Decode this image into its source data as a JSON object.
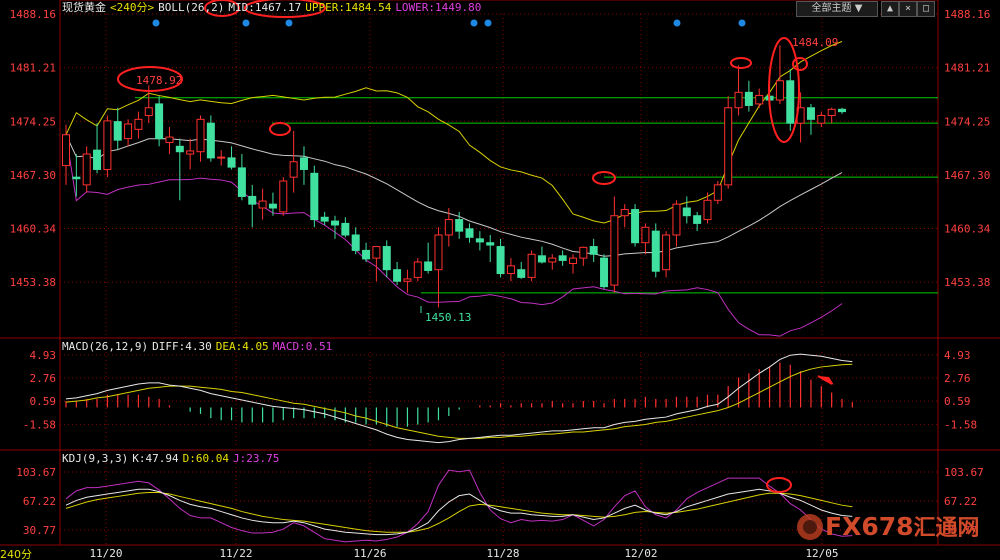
{
  "header": {
    "instrument": "现货黄金",
    "period": "<240分>",
    "boll_label": "BOLL(26,2)",
    "mid": "MID:1467.17",
    "upper": "UPPER:1484.54",
    "lower": "LOWER:1449.80",
    "theme_button": "全部主题",
    "theme_arrow": "▼"
  },
  "toolbar": {
    "up": "▲",
    "close": "×",
    "max": "□"
  },
  "macd_header": {
    "label": "MACD(26,12,9)",
    "diff": "DIFF:4.30",
    "dea": "DEA:4.05",
    "macd": "MACD:0.51"
  },
  "kdj_header": {
    "label": "KDJ(9,3,3)",
    "k": "K:47.94",
    "d": "D:60.04",
    "j": "J:23.75"
  },
  "period_button": "240分",
  "watermark": {
    "text": "FX678",
    "suffix": "汇通网"
  },
  "colors": {
    "up": "#ff3030",
    "down": "#40e0a0",
    "boll_mid": "#c8c8c8",
    "boll_upper": "#d8d000",
    "boll_lower": "#c030c0",
    "hline": "#00cc00",
    "grid": "#8b0000",
    "dea": "#d8d000",
    "diff": "#e8e8e8",
    "k": "#e8e8e8",
    "d": "#d8d000",
    "j": "#c030c0"
  },
  "chart_data": [
    {
      "type": "candlestick",
      "title": "现货黄金 240分",
      "y_ticks": [
        "1488.16",
        "1481.21",
        "1474.25",
        "1467.30",
        "1460.34",
        "1453.38"
      ],
      "ylim": [
        1446.4,
        1488.16
      ],
      "x_labels": [
        "11/20",
        "11/22",
        "11/26",
        "11/28",
        "12/02",
        "12/05"
      ],
      "candles": [
        [
          1468.5,
          1473.8,
          1466.0,
          1472.5
        ],
        [
          1467.0,
          1470.0,
          1464.5,
          1466.8
        ],
        [
          1466.0,
          1471.0,
          1465.0,
          1470.0
        ],
        [
          1470.5,
          1474.0,
          1467.5,
          1468.0
        ],
        [
          1468.0,
          1475.0,
          1467.0,
          1474.3
        ],
        [
          1474.2,
          1476.0,
          1470.5,
          1471.8
        ],
        [
          1472.0,
          1474.5,
          1471.0,
          1473.9
        ],
        [
          1473.2,
          1475.5,
          1472.0,
          1474.5
        ],
        [
          1475.0,
          1478.9,
          1474.0,
          1476.0
        ],
        [
          1476.5,
          1477.5,
          1471.0,
          1472.0
        ],
        [
          1471.5,
          1473.5,
          1470.0,
          1472.2
        ],
        [
          1471.0,
          1472.0,
          1464.0,
          1470.3
        ],
        [
          1470.0,
          1472.0,
          1468.0,
          1470.4
        ],
        [
          1470.3,
          1475.0,
          1469.0,
          1474.5
        ],
        [
          1474.0,
          1475.0,
          1469.0,
          1469.5
        ],
        [
          1469.5,
          1470.5,
          1468.5,
          1469.6
        ],
        [
          1469.5,
          1471.0,
          1468.0,
          1468.3
        ],
        [
          1468.2,
          1470.0,
          1464.0,
          1464.5
        ],
        [
          1464.5,
          1466.0,
          1460.5,
          1463.5
        ],
        [
          1463.0,
          1465.5,
          1461.5,
          1463.9
        ],
        [
          1463.5,
          1465.0,
          1462.0,
          1463.0
        ],
        [
          1462.5,
          1467.0,
          1462.0,
          1466.5
        ],
        [
          1467.0,
          1473.0,
          1465.0,
          1469.0
        ],
        [
          1469.5,
          1471.0,
          1466.0,
          1468.0
        ],
        [
          1467.5,
          1468.5,
          1460.5,
          1461.5
        ],
        [
          1461.8,
          1462.5,
          1460.8,
          1461.3
        ],
        [
          1461.3,
          1462.0,
          1459.0,
          1460.8
        ],
        [
          1461.0,
          1461.8,
          1459.2,
          1459.5
        ],
        [
          1459.5,
          1460.5,
          1457.0,
          1457.5
        ],
        [
          1457.5,
          1458.5,
          1456.0,
          1456.4
        ],
        [
          1456.5,
          1458.0,
          1453.5,
          1458.0
        ],
        [
          1458.0,
          1458.8,
          1454.0,
          1455.0
        ],
        [
          1455.0,
          1456.0,
          1453.0,
          1453.5
        ],
        [
          1453.5,
          1455.0,
          1452.0,
          1453.8
        ],
        [
          1454.0,
          1456.5,
          1453.5,
          1456.0
        ],
        [
          1456.0,
          1458.5,
          1454.5,
          1454.9
        ],
        [
          1455.0,
          1460.5,
          1450.1,
          1459.5
        ],
        [
          1459.5,
          1463.0,
          1458.0,
          1461.5
        ],
        [
          1461.5,
          1462.5,
          1459.0,
          1460.0
        ],
        [
          1460.3,
          1461.0,
          1458.5,
          1459.2
        ],
        [
          1459.0,
          1460.0,
          1457.5,
          1458.6
        ],
        [
          1458.5,
          1459.5,
          1456.0,
          1458.2
        ],
        [
          1458.0,
          1459.0,
          1454.0,
          1454.5
        ],
        [
          1454.5,
          1456.5,
          1453.5,
          1455.5
        ],
        [
          1455.0,
          1456.0,
          1453.8,
          1454.0
        ],
        [
          1454.0,
          1457.5,
          1453.5,
          1457.0
        ],
        [
          1456.8,
          1458.0,
          1455.8,
          1456.0
        ],
        [
          1456.0,
          1457.0,
          1455.0,
          1456.5
        ],
        [
          1456.8,
          1457.5,
          1455.5,
          1456.2
        ],
        [
          1455.8,
          1457.0,
          1454.5,
          1456.5
        ],
        [
          1456.5,
          1458.0,
          1455.5,
          1457.9
        ],
        [
          1458.0,
          1459.0,
          1456.0,
          1457.0
        ],
        [
          1456.5,
          1457.0,
          1452.5,
          1452.8
        ],
        [
          1453.0,
          1464.5,
          1452.0,
          1462.0
        ],
        [
          1462.0,
          1463.5,
          1460.5,
          1462.8
        ],
        [
          1462.8,
          1463.5,
          1458.0,
          1458.5
        ],
        [
          1458.5,
          1461.0,
          1457.0,
          1460.5
        ],
        [
          1460.0,
          1461.0,
          1454.0,
          1454.8
        ],
        [
          1455.0,
          1460.0,
          1454.0,
          1459.5
        ],
        [
          1459.5,
          1464.0,
          1458.0,
          1463.5
        ],
        [
          1463.0,
          1464.5,
          1461.0,
          1462.0
        ],
        [
          1462.0,
          1462.5,
          1460.0,
          1461.0
        ],
        [
          1461.5,
          1465.0,
          1461.0,
          1464.0
        ],
        [
          1464.0,
          1466.5,
          1463.5,
          1466.0
        ],
        [
          1466.0,
          1477.5,
          1465.5,
          1476.0
        ],
        [
          1476.0,
          1481.5,
          1475.0,
          1478.0
        ],
        [
          1478.0,
          1479.5,
          1475.5,
          1476.3
        ],
        [
          1476.5,
          1478.5,
          1476.0,
          1477.6
        ],
        [
          1477.5,
          1480.0,
          1476.5,
          1477.0
        ],
        [
          1477.0,
          1484.1,
          1476.5,
          1479.5
        ],
        [
          1479.5,
          1481.0,
          1473.0,
          1474.0
        ],
        [
          1474.0,
          1478.0,
          1471.5,
          1476.0
        ],
        [
          1476.0,
          1476.5,
          1472.5,
          1474.5
        ],
        [
          1474.0,
          1475.5,
          1473.5,
          1475.0
        ],
        [
          1475.0,
          1476.0,
          1474.0,
          1475.8
        ],
        [
          1475.8,
          1476.0,
          1475.2,
          1475.5
        ]
      ],
      "annotations": {
        "high_labels": [
          "1478.92",
          "1484.09"
        ],
        "low_label": "1450.13",
        "hlines": [
          1477.3,
          1474.0,
          1467.0,
          1452.0
        ]
      }
    },
    {
      "type": "line+bar",
      "title": "MACD(26,12,9)",
      "y_ticks": [
        "4.93",
        "2.76",
        "0.59",
        "-1.58"
      ],
      "ylim": [
        -3.8,
        5.2
      ],
      "series": [
        {
          "name": "DIFF",
          "values": [
            0.8,
            0.9,
            1.1,
            1.3,
            1.6,
            1.8,
            2.0,
            2.2,
            2.3,
            2.3,
            2.1,
            2.0,
            1.8,
            1.6,
            1.3,
            1.1,
            0.9,
            0.7,
            0.5,
            0.3,
            0.1,
            0.0,
            -0.1,
            -0.2,
            -0.4,
            -0.6,
            -0.9,
            -1.2,
            -1.5,
            -1.8,
            -2.1,
            -2.5,
            -2.8,
            -3.0,
            -3.1,
            -3.2,
            -3.3,
            -3.2,
            -3.0,
            -2.9,
            -2.8,
            -2.7,
            -2.6,
            -2.6,
            -2.5,
            -2.4,
            -2.3,
            -2.2,
            -2.2,
            -2.1,
            -2.0,
            -1.9,
            -1.9,
            -1.6,
            -1.4,
            -1.3,
            -1.1,
            -1.0,
            -0.9,
            -0.6,
            -0.4,
            -0.2,
            0.1,
            0.3,
            1.0,
            1.8,
            2.5,
            3.2,
            3.8,
            4.5,
            4.9,
            5.0,
            4.9,
            4.8,
            4.6,
            4.4,
            4.3
          ]
        },
        {
          "name": "DEA",
          "values": [
            0.5,
            0.6,
            0.7,
            0.9,
            1.0,
            1.2,
            1.4,
            1.6,
            1.8,
            1.9,
            2.0,
            2.0,
            2.0,
            1.9,
            1.8,
            1.7,
            1.5,
            1.4,
            1.2,
            1.0,
            0.8,
            0.6,
            0.4,
            0.3,
            0.1,
            -0.1,
            -0.3,
            -0.5,
            -0.8,
            -1.0,
            -1.3,
            -1.6,
            -1.9,
            -2.1,
            -2.3,
            -2.5,
            -2.7,
            -2.8,
            -2.9,
            -2.9,
            -2.9,
            -2.8,
            -2.8,
            -2.7,
            -2.7,
            -2.6,
            -2.5,
            -2.5,
            -2.4,
            -2.3,
            -2.3,
            -2.2,
            -2.1,
            -2.0,
            -1.8,
            -1.7,
            -1.6,
            -1.4,
            -1.3,
            -1.1,
            -0.9,
            -0.7,
            -0.5,
            -0.3,
            0.0,
            0.4,
            0.9,
            1.4,
            1.9,
            2.4,
            2.9,
            3.3,
            3.6,
            3.8,
            3.9,
            4.0,
            4.05
          ]
        }
      ],
      "bars": [
        0.3,
        0.3,
        0.4,
        0.4,
        0.6,
        0.6,
        0.6,
        0.6,
        0.5,
        0.4,
        0.1,
        0.0,
        -0.2,
        -0.3,
        -0.5,
        -0.6,
        -0.6,
        -0.7,
        -0.7,
        -0.7,
        -0.7,
        -0.6,
        -0.5,
        -0.5,
        -0.5,
        -0.5,
        -0.6,
        -0.7,
        -0.7,
        -0.8,
        -0.8,
        -0.9,
        -0.9,
        -0.9,
        -0.8,
        -0.7,
        -0.6,
        -0.4,
        -0.1,
        0.0,
        0.1,
        0.1,
        0.2,
        0.1,
        0.2,
        0.2,
        0.2,
        0.3,
        0.2,
        0.2,
        0.3,
        0.3,
        0.2,
        0.4,
        0.4,
        0.4,
        0.5,
        0.4,
        0.4,
        0.5,
        0.5,
        0.5,
        0.6,
        0.6,
        1.0,
        1.4,
        1.6,
        1.8,
        1.9,
        2.1,
        2.0,
        1.7,
        1.3,
        1.0,
        0.7,
        0.4,
        0.25
      ]
    },
    {
      "type": "line",
      "title": "KDJ(9,3,3)",
      "y_ticks": [
        "103.67",
        "67.22",
        "30.77"
      ],
      "ylim": [
        12,
        115
      ],
      "series": [
        {
          "name": "K",
          "values": [
            62,
            68,
            72,
            74,
            76,
            78,
            80,
            82,
            82,
            79,
            74,
            68,
            63,
            60,
            58,
            54,
            50,
            46,
            43,
            41,
            40,
            40,
            42,
            40,
            36,
            32,
            30,
            28,
            27,
            26,
            25,
            25,
            26,
            28,
            33,
            40,
            55,
            66,
            74,
            76,
            68,
            60,
            55,
            52,
            52,
            50,
            49,
            48,
            48,
            50,
            47,
            44,
            46,
            52,
            58,
            62,
            56,
            52,
            50,
            54,
            60,
            64,
            68,
            72,
            76,
            78,
            80,
            82,
            80,
            77,
            72,
            68,
            62,
            56,
            52,
            49,
            47.94
          ]
        },
        {
          "name": "D",
          "values": [
            58,
            62,
            66,
            69,
            71,
            73,
            75,
            77,
            78,
            78,
            76,
            73,
            70,
            67,
            64,
            61,
            58,
            54,
            51,
            48,
            46,
            44,
            43,
            42,
            40,
            38,
            36,
            34,
            32,
            30,
            29,
            28,
            28,
            28,
            30,
            33,
            39,
            46,
            54,
            61,
            63,
            62,
            60,
            58,
            56,
            54,
            52,
            51,
            50,
            50,
            49,
            48,
            47,
            48,
            50,
            53,
            54,
            53,
            52,
            53,
            55,
            57,
            60,
            63,
            66,
            69,
            72,
            75,
            77,
            77,
            76,
            74,
            71,
            68,
            65,
            62,
            60.04
          ]
        },
        {
          "name": "J",
          "values": [
            70,
            80,
            84,
            84,
            86,
            88,
            90,
            92,
            90,
            81,
            70,
            58,
            49,
            46,
            46,
            40,
            34,
            30,
            27,
            27,
            28,
            32,
            40,
            36,
            28,
            20,
            18,
            16,
            17,
            18,
            17,
            19,
            22,
            28,
            39,
            54,
            87,
            106,
            104,
            106,
            78,
            56,
            45,
            40,
            44,
            42,
            43,
            42,
            44,
            50,
            43,
            36,
            44,
            60,
            74,
            80,
            60,
            50,
            46,
            56,
            70,
            78,
            84,
            90,
            96,
            96,
            96,
            96,
            86,
            77,
            64,
            56,
            44,
            32,
            26,
            23,
            23.75
          ]
        }
      ]
    }
  ]
}
